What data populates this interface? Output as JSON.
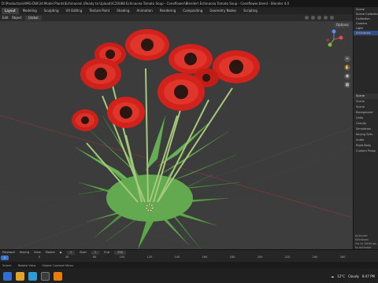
{
  "window": {
    "title": "D:\\Production\\AMG-DW\\3d Model Plants\\Echinacea\\ (Ready to Upload)\\C20088 Echinacea Tomato Soup - Coneflower\\Blender\\ Echinacea Tomato Soup - Coneflower.blend - Blender 4.0"
  },
  "menubar": {
    "tabs": [
      "Layout",
      "Modeling",
      "Sculpting",
      "UV Editing",
      "Texture Paint",
      "Shading",
      "Animation",
      "Rendering",
      "Compositing",
      "Geometry Nodes",
      "Scripting"
    ],
    "active_tab": "Layout",
    "scene": "Scene"
  },
  "viewport_header": {
    "mode": "Edit",
    "menu_object": "Object",
    "transform": "Global",
    "options": "Options"
  },
  "outliner": {
    "rows": [
      "Scene Collection",
      "Collection",
      "Camera",
      "Light",
      "Echinacea"
    ]
  },
  "properties": {
    "rows": [
      "Scene",
      "Scene",
      "Background",
      "Units",
      "Gravity",
      "Simulation",
      "Keying Sets",
      "Audio",
      "Rigid Body",
      "Custom Props"
    ],
    "head": "Scene"
  },
  "watermark": {
    "line1": "Activate Windows",
    "line2": "Go to Settings to activate Windows."
  },
  "timeline": {
    "playback": "Playback",
    "keying": "Keying",
    "view": "View",
    "marker": "Marker",
    "current_frame": "1",
    "start_label": "Start",
    "start": "1",
    "end_label": "End",
    "end": "250",
    "ticks": [
      "0",
      "40",
      "60",
      "100",
      "120",
      "140",
      "160",
      "180",
      "200",
      "220",
      "240",
      "260"
    ]
  },
  "statusbar": {
    "select": "Select",
    "rotate": "Rotate View",
    "context": "Object Context Menu"
  },
  "taskbar": {
    "temp": "12°C",
    "weather": "Cloudy",
    "time": "8:47 PM"
  },
  "colors": {
    "accent": "#3a74c8",
    "petal": "#d3221c",
    "leaf": "#5ea64a",
    "center": "#2b1611",
    "stem": "#9bc16c"
  }
}
